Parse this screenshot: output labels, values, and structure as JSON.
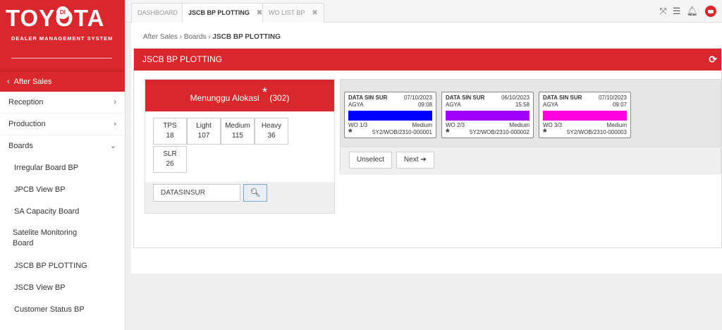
{
  "brand": {
    "logo": "TOYOTA",
    "badge": "DI",
    "subtitle": "DEALER MANAGEMENT SYSTEM"
  },
  "sidebar": {
    "section": "After Sales",
    "items": [
      {
        "label": "Reception",
        "arrow": "›"
      },
      {
        "label": "Production",
        "arrow": "›"
      },
      {
        "label": "Boards",
        "arrow": "⌄"
      }
    ],
    "sub_items": [
      "Irregular Board BP",
      "JPCB View BP",
      "SA Capacity Board",
      "Satelite Monitoring Board",
      "JSCB BP PLOTTING",
      "JSCB View BP",
      "Customer Status BP"
    ]
  },
  "tabs": [
    {
      "label": "DASHBOARD",
      "active": false
    },
    {
      "label": "JSCB BP PLOTTING",
      "active": true
    },
    {
      "label": "WO LIST BP",
      "active": false
    }
  ],
  "breadcrumb": {
    "a": "After Sales",
    "b": "Boards",
    "current": "JSCB BP PLOTTING"
  },
  "panel": {
    "title": "JSCB BP PLOTTING"
  },
  "allocation": {
    "title": "Menunggu Alokasi",
    "star": "*",
    "count": "(302)",
    "categories": [
      {
        "label": "TPS",
        "value": "18"
      },
      {
        "label": "Light",
        "value": "107"
      },
      {
        "label": "Medium",
        "value": "115"
      },
      {
        "label": "Heavy",
        "value": "36"
      },
      {
        "label": "SLR",
        "value": "26"
      }
    ],
    "search_value": "DATASINSUR"
  },
  "wo_cards": [
    {
      "name": "DATA SIN SUR",
      "date": "07/10/2023",
      "model": "AGYA",
      "time": "09:08",
      "color": "#0000ff",
      "wo": "WO 1/3",
      "level": "Medium",
      "star": "*",
      "number": "5Y2/WOB/2310-000001"
    },
    {
      "name": "DATA SIN SUR",
      "date": "06/10/2023",
      "model": "AGYA",
      "time": "15:58",
      "color": "#a100ff",
      "wo": "WO 2/3",
      "level": "Medium",
      "star": "*",
      "number": "5Y2/WOB/2310-000002"
    },
    {
      "name": "DATA SIN SUR",
      "date": "07/10/2023",
      "model": "AGYA",
      "time": "09:07",
      "color": "#ff00e0",
      "wo": "WO 3/3",
      "level": "Medium",
      "star": "*",
      "number": "5Y2/WOB/2310-000003"
    }
  ],
  "buttons": {
    "unselect": "Unselect",
    "next": "Next"
  },
  "colors": {
    "brand_red": "#d9272e"
  }
}
